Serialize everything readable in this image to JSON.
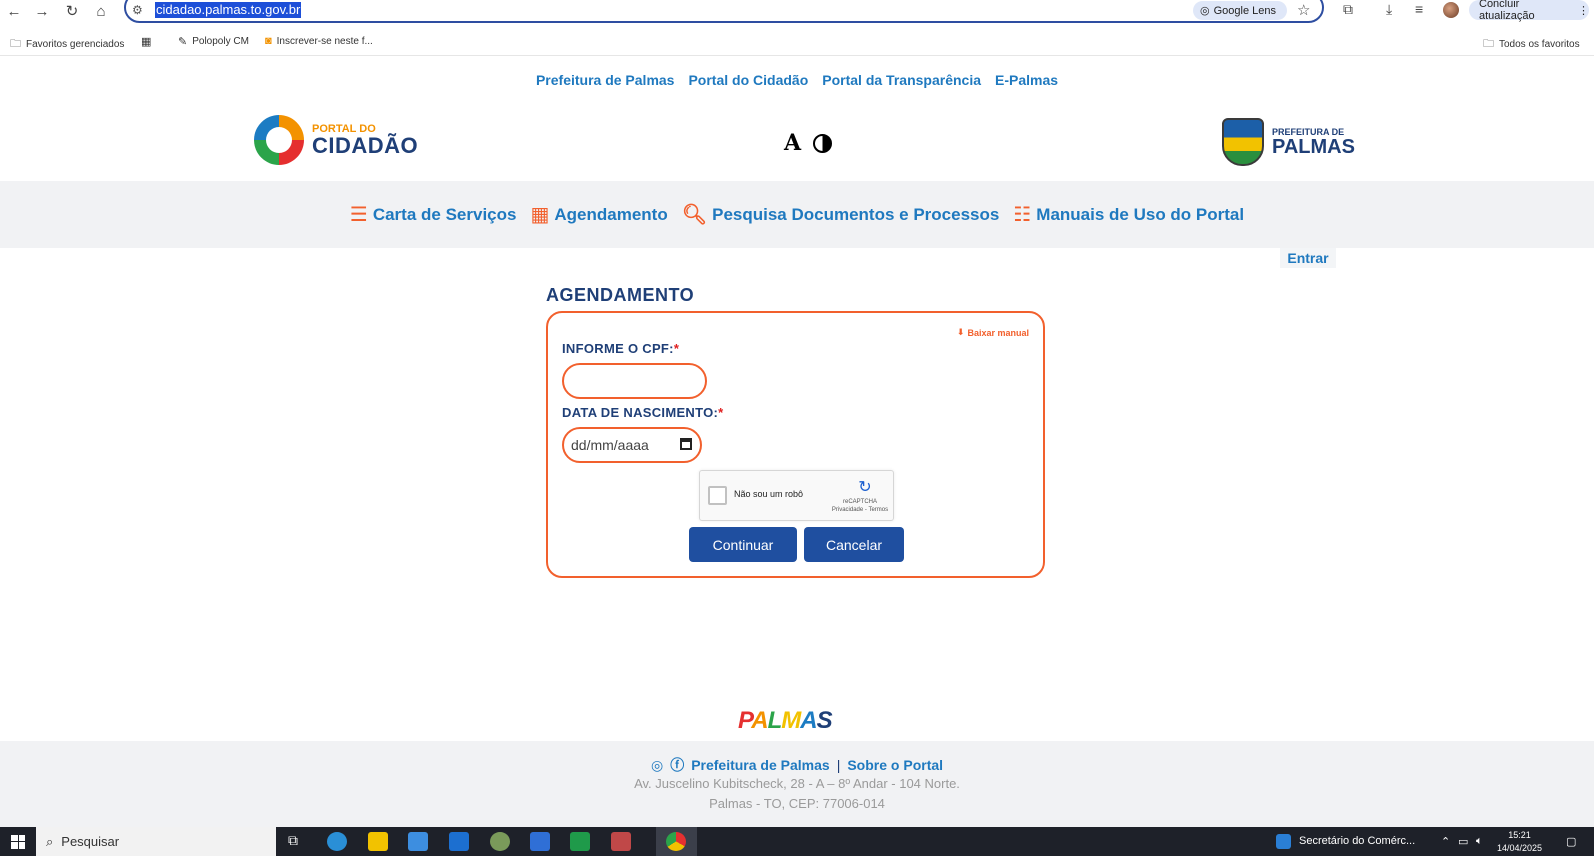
{
  "browser": {
    "url": "cidadao.palmas.to.gov.br",
    "lens_label": "Google Lens",
    "update_label": "Concluir atualização",
    "bookmarks": [
      "Favoritos gerenciados",
      "Polopoly CM",
      "Inscrever-se neste f...",
      "Todos os favoritos"
    ]
  },
  "site": {
    "top_links": [
      "Prefeitura de Palmas",
      "Portal do Cidadão",
      "Portal da Transparência",
      "E-Palmas"
    ],
    "logo_left": {
      "small": "PORTAL DO",
      "big": "CIDADÃO"
    },
    "logo_right": {
      "small": "PREFEITURA DE",
      "big": "PALMAS"
    },
    "a11y_font_label": "A",
    "menu": [
      {
        "label": "Carta de Serviços",
        "icon": "list-alt-icon"
      },
      {
        "label": "Agendamento",
        "icon": "calendar-icon"
      },
      {
        "label": "Pesquisa Documentos e Processos",
        "icon": "search-icon"
      },
      {
        "label": "Manuais de Uso do Portal",
        "icon": "list-icon"
      }
    ],
    "login_label": "Entrar"
  },
  "form": {
    "title": "AGENDAMENTO",
    "manual_link": "Baixar manual",
    "cpf_label": "INFORME O CPF:",
    "cpf_value": "",
    "birth_label": "DATA DE NASCIMENTO:",
    "birth_placeholder": "dd/mm/aaaa",
    "required_mark": "*",
    "recaptcha_label": "Não sou um robô",
    "recaptcha_brand": "reCAPTCHA",
    "recaptcha_links": "Privacidade - Termos",
    "continue_label": "Continuar",
    "cancel_label": "Cancelar"
  },
  "footer": {
    "brand": "PALMAS",
    "link_prefeitura": "Prefeitura de Palmas",
    "separator": "|",
    "link_sobre": "Sobre o Portal",
    "address_line1": "Av. Juscelino Kubitscheck, 28 - A – 8º Andar - 104 Norte.",
    "address_line2": "Palmas - TO, CEP: 77006-014"
  },
  "taskbar": {
    "search_label": "Pesquisar",
    "tray_app": "Secretário do Comérc...",
    "time": "15:21",
    "date": "14/04/2025"
  },
  "colors": {
    "accent_orange": "#f2602d",
    "link_blue": "#1f79bf",
    "navy": "#1f3f77",
    "button_blue": "#1f4fa0"
  }
}
